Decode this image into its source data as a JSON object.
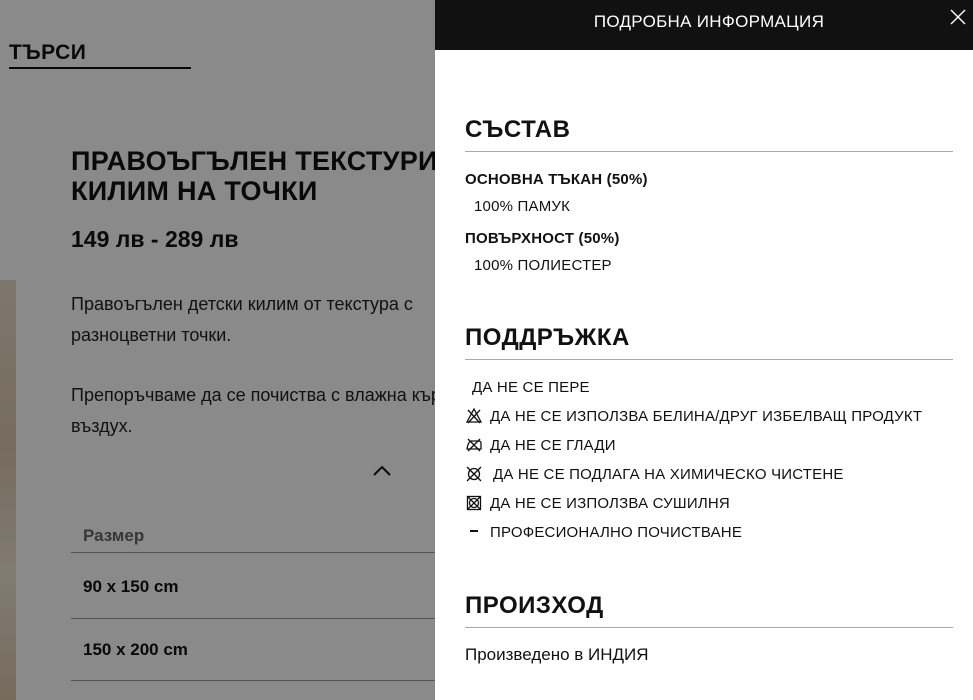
{
  "background": {
    "search_label": "ТЪРСИ",
    "product_title_line1": "ПРАВОЪГЪЛЕН ТЕКСТУРИРАН",
    "product_title_line2": "КИЛИМ НА ТОЧКИ",
    "price": "149 лв - 289 лв",
    "description_1_line1": "Правоъгълен детски килим от текстура с",
    "description_1_line2": "разноцветни точки.",
    "description_2_line1": "Препоръчваме да се почиства с влажна кърпа на",
    "description_2_line2": "въздух.",
    "size_header": "Размер",
    "sizes": [
      "90 x 150 cm",
      "150 x 200 cm"
    ]
  },
  "panel": {
    "title": "ПОДРОБНА ИНФОРМАЦИЯ",
    "composition": {
      "title": "СЪСТАВ",
      "items": [
        {
          "label": "ОСНОВНА ТЪКАН (50%)",
          "value": "100% ПАМУК"
        },
        {
          "label": "ПОВЪРХНОСТ (50%)",
          "value": "100% ПОЛИЕСТЕР"
        }
      ]
    },
    "care": {
      "title": "ПОДДРЪЖКА",
      "items": [
        {
          "icon": "no-wash-icon",
          "text": "ДА НЕ СЕ ПЕРЕ"
        },
        {
          "icon": "no-bleach-icon",
          "text": "ДА НЕ СЕ ИЗПОЛЗВА БЕЛИНА/ДРУГ ИЗБЕЛВАЩ ПРОДУКТ"
        },
        {
          "icon": "no-iron-icon",
          "text": "ДА НЕ СЕ ГЛАДИ"
        },
        {
          "icon": "no-dry-clean-icon",
          "text": "ДА НЕ СЕ ПОДЛАГА НА ХИМИЧЕСКО ЧИСТЕНЕ"
        },
        {
          "icon": "no-tumble-dry-icon",
          "text": "ДА НЕ СЕ ИЗПОЛЗВА СУШИЛНЯ"
        },
        {
          "icon": "professional-clean-icon",
          "text": "ПРОФЕСИОНАЛНО ПОЧИСТВАНЕ"
        }
      ]
    },
    "origin": {
      "title": "ПРОИЗХОД",
      "text": "Произведено в ИНДИЯ"
    }
  },
  "colors": {
    "header_bg": "#111111",
    "overlay": "rgba(0,0,0,0.46)"
  }
}
